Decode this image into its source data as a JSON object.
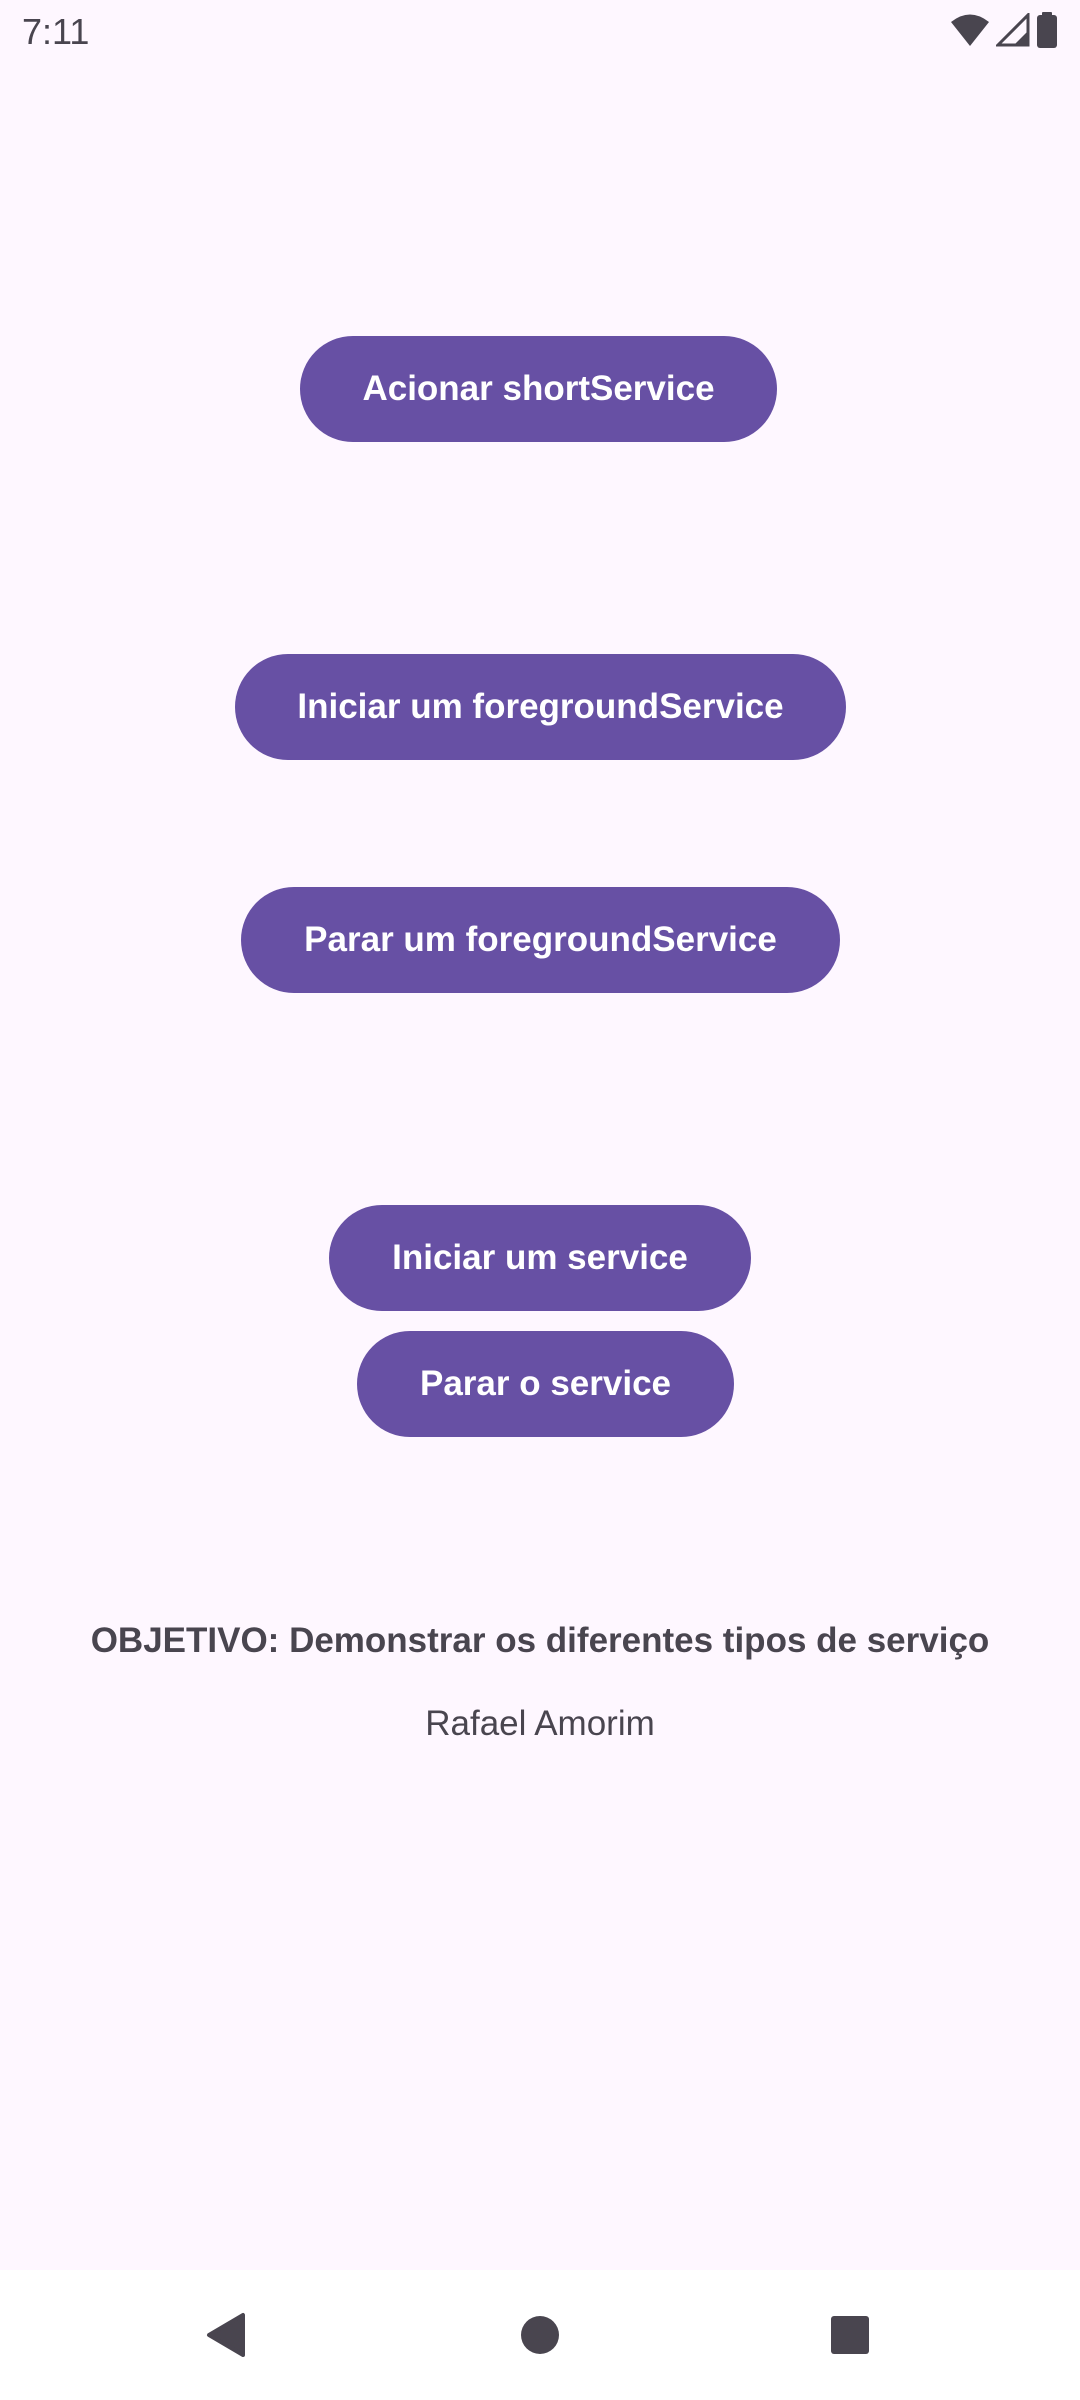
{
  "status_bar": {
    "time": "7:11",
    "icons": [
      "wifi-icon",
      "signal-icon",
      "battery-icon"
    ]
  },
  "buttons": {
    "short_service": "Acionar shortService",
    "start_foreground": "Iniciar um foregroundService",
    "stop_foreground": "Parar um foregroundService",
    "start_service": "Iniciar um service",
    "stop_service": "Parar o service"
  },
  "objective": "OBJETIVO: Demonstrar os diferentes tipos de serviço",
  "author": "Rafael Amorim",
  "nav_bar": {
    "icons": [
      "back-icon",
      "home-icon",
      "recents-icon"
    ]
  },
  "colors": {
    "primary": "#6750A4",
    "background": "#FEF7FF",
    "text": "#49454F",
    "on_primary": "#FFFFFF"
  }
}
